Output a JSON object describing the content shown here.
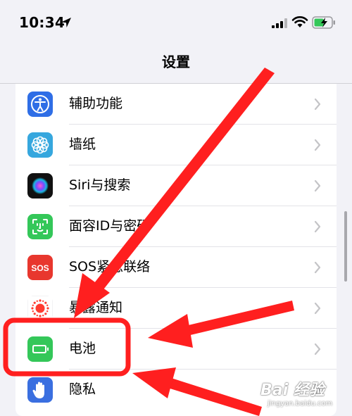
{
  "status_bar": {
    "time": "10:34"
  },
  "header": {
    "title": "设置"
  },
  "rows": [
    {
      "label": "辅助功能",
      "icon": "accessibility-icon",
      "color": "#2f6ee6"
    },
    {
      "label": "墙纸",
      "icon": "wallpaper-flower-icon",
      "color": "#36a7de"
    },
    {
      "label": "Siri与搜索",
      "icon": "siri-icon",
      "color": "#1a1a2e"
    },
    {
      "label": "面容ID与密码",
      "icon": "face-id-icon",
      "color": "#34c759"
    },
    {
      "label": "SOS紧急联络",
      "icon": "sos-icon",
      "color": "#e8372e",
      "badge": "SOS"
    },
    {
      "label": "暴露通知",
      "icon": "exposure-notification-icon",
      "color": "#ff3b30"
    },
    {
      "label": "电池",
      "icon": "battery-icon",
      "color": "#34c759"
    },
    {
      "label": "隐私",
      "icon": "privacy-hand-icon",
      "color": "#3a6fe0"
    }
  ],
  "watermark": {
    "line1": "Bai 经验",
    "line2": "jingyan.baidu.com"
  },
  "annotation_color": "#ff1f1f"
}
